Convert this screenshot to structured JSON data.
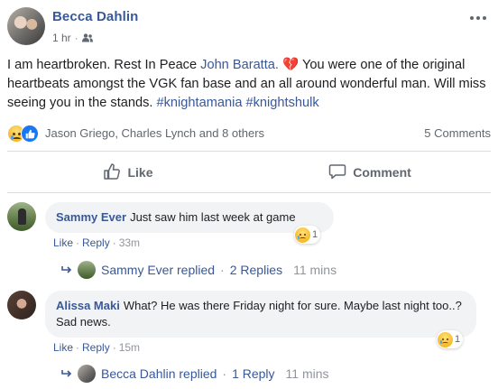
{
  "post": {
    "author": "Becca Dahlin",
    "time": "1 hr",
    "audience_icon": "friends-icon",
    "text_before": "I am heartbroken. Rest In Peace ",
    "mention": "John Baratta.",
    "text_mid": " 💔 You were one of the original heartbeats amongst the VGK fan base and an all around wonderful man. Will miss seeing you in the stands. ",
    "hashtag1": "#knightamania",
    "hashtag2": "#knightshulk"
  },
  "reactions": {
    "names": "Jason Griego, Charles Lynch and 8 others",
    "comments_count": "5 Comments"
  },
  "actions": {
    "like_label": "Like",
    "comment_label": "Comment"
  },
  "comments": [
    {
      "author": "Sammy Ever",
      "text": "Just saw him last week at game",
      "like": "Like",
      "reply": "Reply",
      "time": "33m",
      "reaction_count": "1",
      "replied_by": "Sammy Ever replied",
      "replies": "2 Replies",
      "reply_time": "11 mins"
    },
    {
      "author": "Alissa Maki",
      "text": "What? He was there Friday night for sure. Maybe last night too..? Sad news.",
      "like": "Like",
      "reply": "Reply",
      "time": "15m",
      "reaction_count": "1",
      "replied_by": "Becca Dahlin replied",
      "replies": "1 Reply",
      "reply_time": "11 mins"
    }
  ],
  "colors": {
    "link": "#385898",
    "muted": "#606770",
    "bubble": "#f2f3f5",
    "like_blue": "#1877f2"
  }
}
